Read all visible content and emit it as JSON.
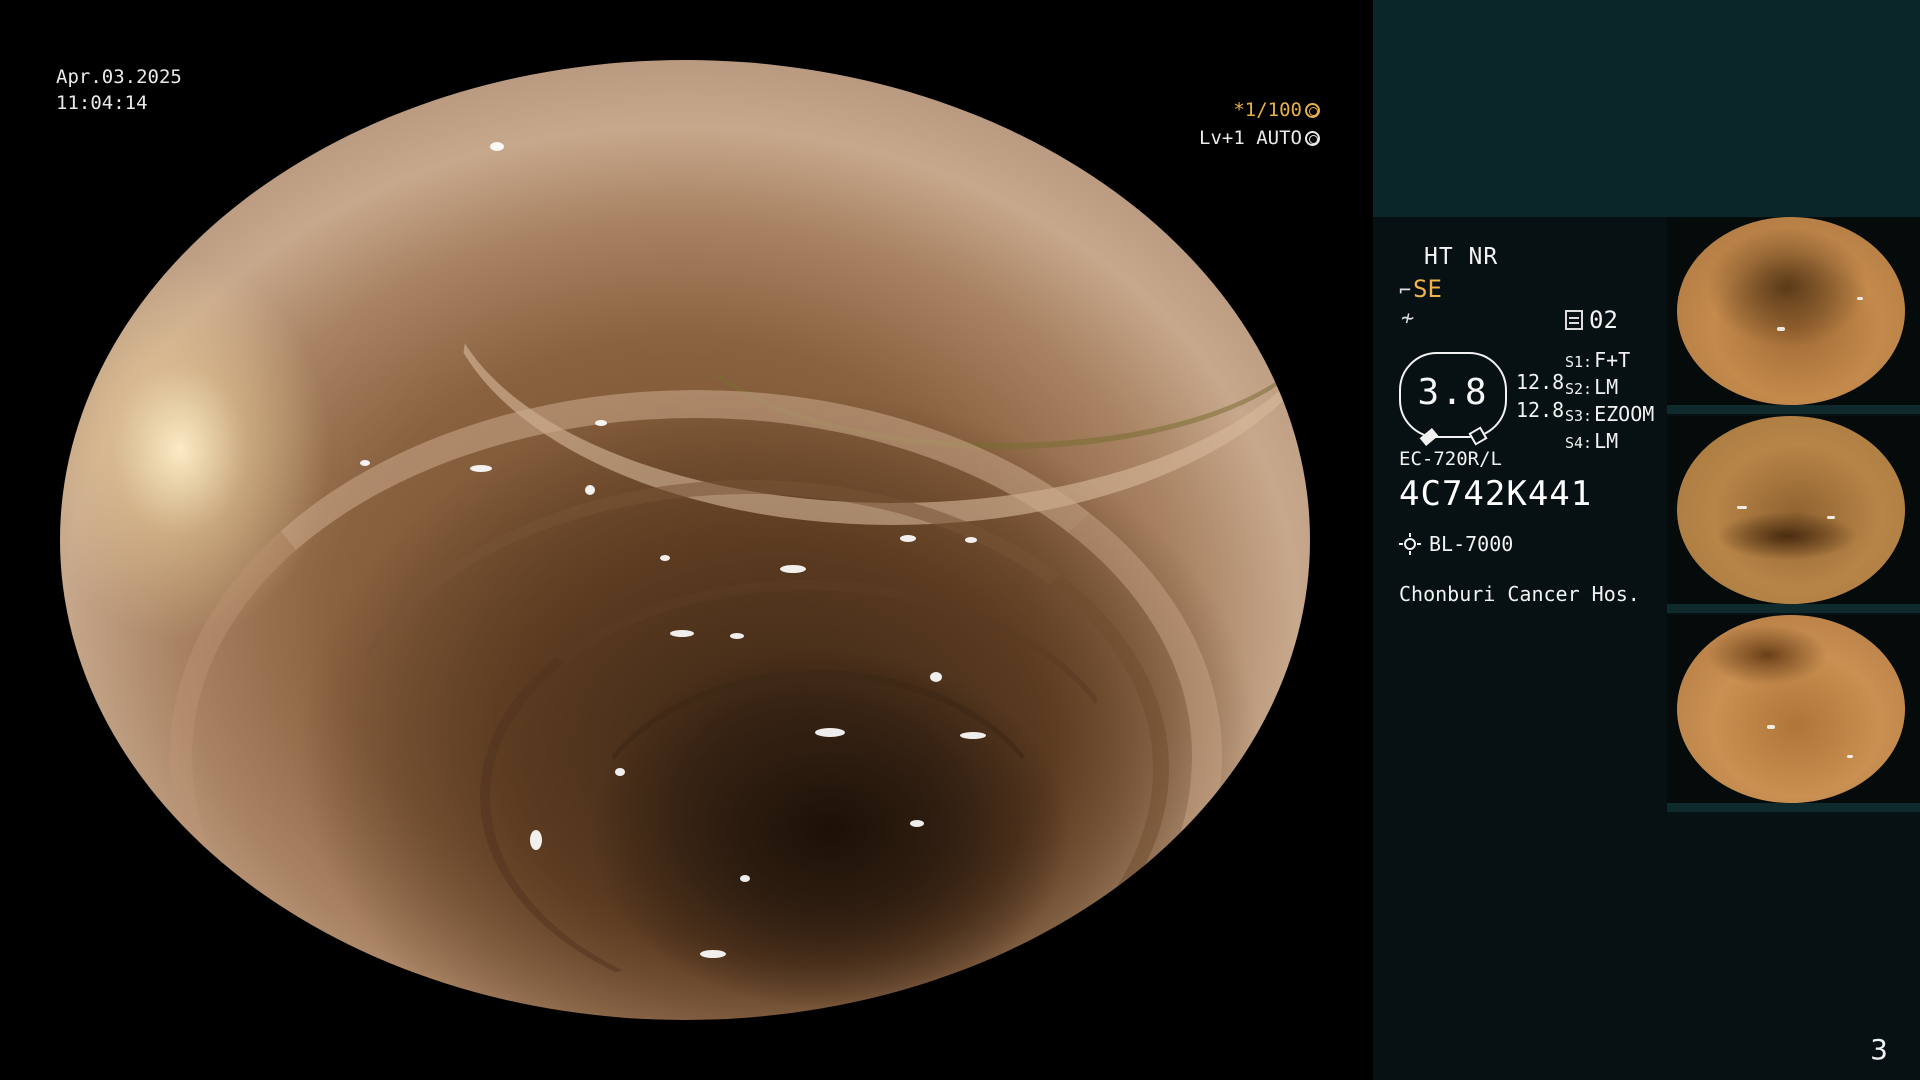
{
  "scope_view": {
    "date": "Apr.03.2025",
    "time": "11:04:14",
    "shutter": "*1/100",
    "level": "Lv+1 AUTO"
  },
  "info": {
    "ht_nr": "HT NR",
    "se": "SE",
    "memory": "02",
    "zoom_value": "3.8",
    "value_a": "12.8",
    "value_b": "12.8",
    "switches": [
      {
        "key": "S1:",
        "value": "F+T"
      },
      {
        "key": "S2:",
        "value": "LM"
      },
      {
        "key": "S3:",
        "value": "EZOOM"
      },
      {
        "key": "S4:",
        "value": "LM"
      }
    ],
    "scope_model": "EC-720R/L",
    "scope_serial": "4C742K441",
    "light_source": "BL-7000",
    "hospital": "Chonburi Cancer Hos."
  },
  "thumbnails_count": 3,
  "page_number": "3"
}
